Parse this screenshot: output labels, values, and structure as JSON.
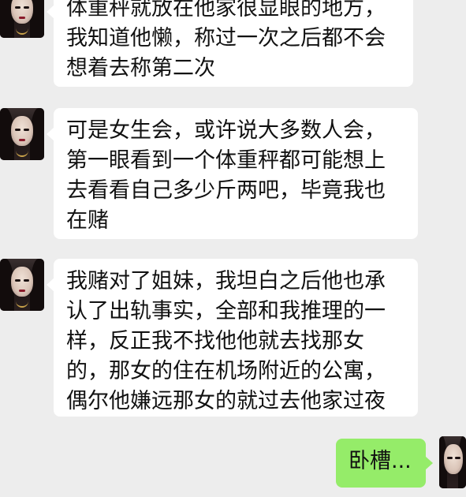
{
  "messages": [
    {
      "sender": "other",
      "lines": [
        "体重秤就放在他家很显眼的地方，",
        "我知道他懒，称过一次之后都不会",
        "想着去称第二次"
      ]
    },
    {
      "sender": "other",
      "lines": [
        "可是女生会，或许说大多数人会，",
        "第一眼看到一个体重秤都可能想上",
        "去看看自己多少斤两吧，毕竟我也",
        "在赌"
      ]
    },
    {
      "sender": "other",
      "lines": [
        "我赌对了姐妹，我坦白之后他也承",
        "认了出轨事实，全部和我推理的一",
        "样，反正我不找他他就去找那女",
        "的，那女的住在机场附近的公寓，",
        "偶尔他嫌远那女的就过去他家过夜"
      ]
    },
    {
      "sender": "self",
      "lines": [
        "卧槽..."
      ]
    }
  ],
  "colors": {
    "background": "#ededed",
    "incoming_bubble": "#ffffff",
    "outgoing_bubble": "#95ec69"
  }
}
